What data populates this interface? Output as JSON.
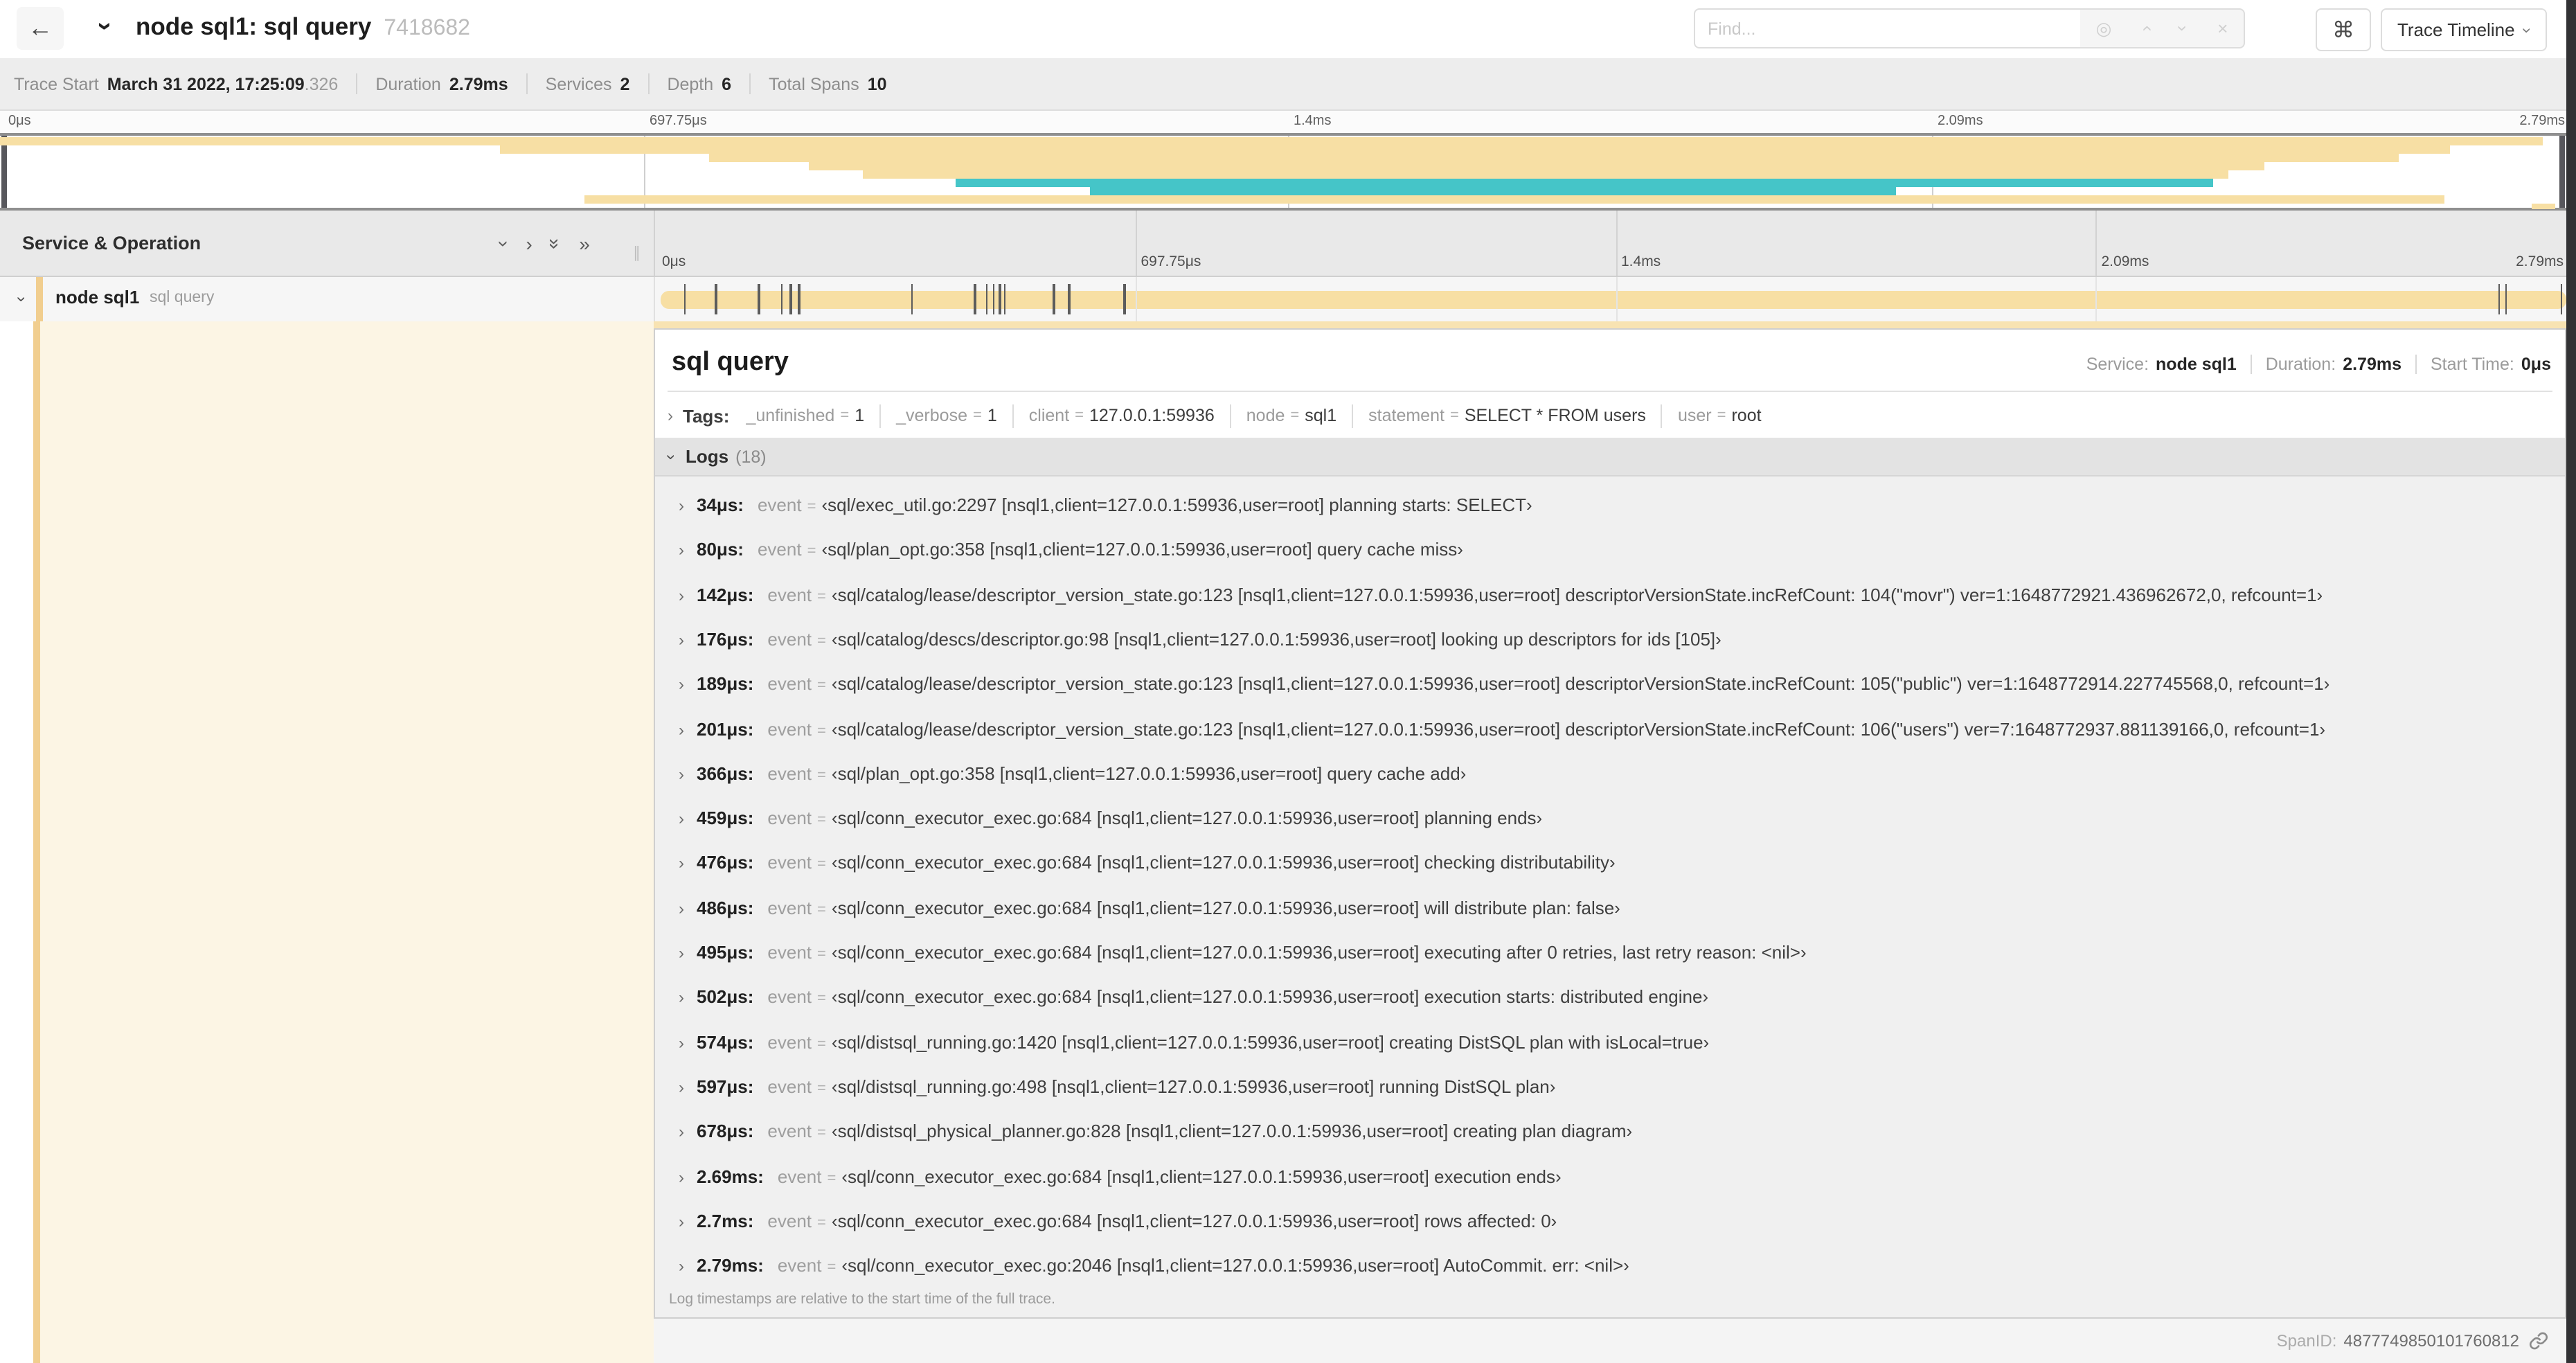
{
  "header": {
    "back_icon": "←",
    "title": "node sql1: sql query",
    "trace_id_short": "7418682",
    "find_placeholder": "Find...",
    "find_target_icon": "◎",
    "find_prev_icon": "›",
    "find_next_icon": "›",
    "find_clear_icon": "×",
    "shortcut_icon": "⌘",
    "view_dropdown_label": "Trace Timeline"
  },
  "trace_info": {
    "items": [
      {
        "label": "Trace Start",
        "value": "March 31 2022, 17:25:09",
        "suffix": ".326"
      },
      {
        "label": "Duration",
        "value": "2.79ms"
      },
      {
        "label": "Services",
        "value": "2"
      },
      {
        "label": "Depth",
        "value": "6"
      },
      {
        "label": "Total Spans",
        "value": "10"
      }
    ]
  },
  "timeline": {
    "left_header": "Service & Operation",
    "resizer_icon": "∥",
    "collapse_icons": [
      "chevron-down",
      "chevron-right",
      "double-chevron-down",
      "double-chevron-right"
    ],
    "ticks": [
      {
        "label": "0μs",
        "pct": 0
      },
      {
        "label": "697.75μs",
        "pct": 25
      },
      {
        "label": "1.4ms",
        "pct": 50
      },
      {
        "label": "2.09ms",
        "pct": 75
      },
      {
        "label": "2.79ms",
        "pct": 100
      }
    ],
    "row": {
      "service": "node sql1",
      "operation": "sql query"
    },
    "marker_times_us": [
      34,
      80,
      142,
      176,
      189,
      201,
      366,
      459,
      476,
      486,
      495,
      502,
      574,
      597,
      678,
      2690,
      2700,
      2790
    ],
    "total_us": 2790
  },
  "minimap": {
    "rows": [
      {
        "c": "tan",
        "s": 0,
        "e": 98.7
      },
      {
        "c": "tan",
        "s": 19.4,
        "e": 95.1
      },
      {
        "c": "tan",
        "s": 27.5,
        "e": 93.1
      },
      {
        "c": "tan",
        "s": 31.4,
        "e": 87.9
      },
      {
        "c": "tan",
        "s": 33.5,
        "e": 86.5
      },
      {
        "c": "teal",
        "s": 37.1,
        "e": 85.9
      },
      {
        "c": "teal",
        "s": 42.3,
        "e": 73.6
      },
      {
        "c": "tan",
        "s": 22.7,
        "e": 94.9
      },
      {
        "c": "tan",
        "s": 98.3,
        "e": 99.2
      }
    ]
  },
  "detail": {
    "title": "sql query",
    "meta": {
      "service_label": "Service:",
      "service": "node sql1",
      "duration_label": "Duration:",
      "duration": "2.79ms",
      "start_label": "Start Time:",
      "start": "0μs"
    },
    "tags": {
      "label": "Tags:",
      "items": [
        {
          "key": "_unfinished",
          "value": "1"
        },
        {
          "key": "_verbose",
          "value": "1"
        },
        {
          "key": "client",
          "value": "127.0.0.1:59936"
        },
        {
          "key": "node",
          "value": "sql1"
        },
        {
          "key": "statement",
          "value": "SELECT * FROM users"
        },
        {
          "key": "user",
          "value": "root"
        }
      ]
    },
    "logs": {
      "label": "Logs",
      "count": "(18)",
      "entries": [
        {
          "time": "34μs:",
          "key": "event",
          "eq": "=",
          "value": "‹sql/exec_util.go:2297 [nsql1,client=127.0.0.1:59936,user=root] planning starts: SELECT›"
        },
        {
          "time": "80μs:",
          "key": "event",
          "eq": "=",
          "value": "‹sql/plan_opt.go:358 [nsql1,client=127.0.0.1:59936,user=root] query cache miss›"
        },
        {
          "time": "142μs:",
          "key": "event",
          "eq": "=",
          "value": "‹sql/catalog/lease/descriptor_version_state.go:123 [nsql1,client=127.0.0.1:59936,user=root] descriptorVersionState.incRefCount: 104(\"movr\") ver=1:1648772921.436962672,0, refcount=1›"
        },
        {
          "time": "176μs:",
          "key": "event",
          "eq": "=",
          "value": "‹sql/catalog/descs/descriptor.go:98 [nsql1,client=127.0.0.1:59936,user=root] looking up descriptors for ids [105]›"
        },
        {
          "time": "189μs:",
          "key": "event",
          "eq": "=",
          "value": "‹sql/catalog/lease/descriptor_version_state.go:123 [nsql1,client=127.0.0.1:59936,user=root] descriptorVersionState.incRefCount: 105(\"public\") ver=1:1648772914.227745568,0, refcount=1›"
        },
        {
          "time": "201μs:",
          "key": "event",
          "eq": "=",
          "value": "‹sql/catalog/lease/descriptor_version_state.go:123 [nsql1,client=127.0.0.1:59936,user=root] descriptorVersionState.incRefCount: 106(\"users\") ver=7:1648772937.881139166,0, refcount=1›"
        },
        {
          "time": "366μs:",
          "key": "event",
          "eq": "=",
          "value": "‹sql/plan_opt.go:358 [nsql1,client=127.0.0.1:59936,user=root] query cache add›"
        },
        {
          "time": "459μs:",
          "key": "event",
          "eq": "=",
          "value": "‹sql/conn_executor_exec.go:684 [nsql1,client=127.0.0.1:59936,user=root] planning ends›"
        },
        {
          "time": "476μs:",
          "key": "event",
          "eq": "=",
          "value": "‹sql/conn_executor_exec.go:684 [nsql1,client=127.0.0.1:59936,user=root] checking distributability›"
        },
        {
          "time": "486μs:",
          "key": "event",
          "eq": "=",
          "value": "‹sql/conn_executor_exec.go:684 [nsql1,client=127.0.0.1:59936,user=root] will distribute plan: false›"
        },
        {
          "time": "495μs:",
          "key": "event",
          "eq": "=",
          "value": "‹sql/conn_executor_exec.go:684 [nsql1,client=127.0.0.1:59936,user=root] executing after 0 retries, last retry reason: <nil>›"
        },
        {
          "time": "502μs:",
          "key": "event",
          "eq": "=",
          "value": "‹sql/conn_executor_exec.go:684 [nsql1,client=127.0.0.1:59936,user=root] execution starts: distributed engine›"
        },
        {
          "time": "574μs:",
          "key": "event",
          "eq": "=",
          "value": "‹sql/distsql_running.go:1420 [nsql1,client=127.0.0.1:59936,user=root] creating DistSQL plan with isLocal=true›"
        },
        {
          "time": "597μs:",
          "key": "event",
          "eq": "=",
          "value": "‹sql/distsql_running.go:498 [nsql1,client=127.0.0.1:59936,user=root] running DistSQL plan›"
        },
        {
          "time": "678μs:",
          "key": "event",
          "eq": "=",
          "value": "‹sql/distsql_physical_planner.go:828 [nsql1,client=127.0.0.1:59936,user=root] creating plan diagram›"
        },
        {
          "time": "2.69ms:",
          "key": "event",
          "eq": "=",
          "value": "‹sql/conn_executor_exec.go:684 [nsql1,client=127.0.0.1:59936,user=root] execution ends›"
        },
        {
          "time": "2.7ms:",
          "key": "event",
          "eq": "=",
          "value": "‹sql/conn_executor_exec.go:684 [nsql1,client=127.0.0.1:59936,user=root] rows affected: 0›"
        },
        {
          "time": "2.79ms:",
          "key": "event",
          "eq": "=",
          "value": "‹sql/conn_executor_exec.go:2046 [nsql1,client=127.0.0.1:59936,user=root] AutoCommit. err: <nil>›"
        }
      ],
      "footnote": "Log timestamps are relative to the start time of the full trace."
    },
    "span_id_label": "SpanID:",
    "span_id": "4877749850101760812"
  },
  "colors": {
    "tan": "#F7DFA4",
    "teal": "#45C5C8",
    "accent": "#F1CE8F",
    "cream": "#FCF5E4",
    "strip": "#F8E3B2"
  }
}
